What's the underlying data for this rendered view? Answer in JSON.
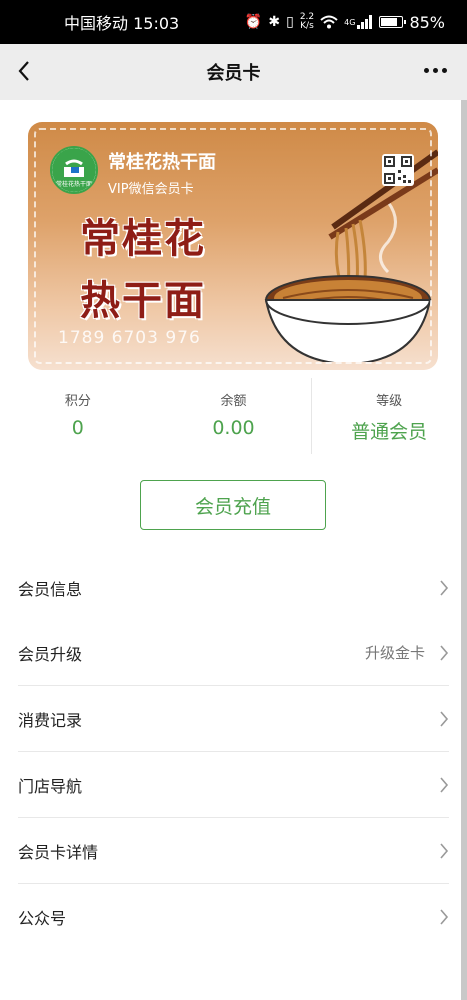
{
  "status_bar": {
    "carrier_time": "中国移动 15:03",
    "speed_top": "2.2",
    "speed_bottom": "K/s",
    "network": "4G",
    "battery_percent": "85%",
    "battery_level": 0.85
  },
  "nav": {
    "title": "会员卡"
  },
  "card": {
    "store_name": "常桂花热干面",
    "card_type": "VIP微信会员卡",
    "big_title_line1": "常桂花",
    "big_title_line2": "热干面",
    "card_number": "1789 6703 976",
    "logo_text": "常桂花热干面",
    "colors": {
      "title_red": "#8e1d16",
      "card_orange": "#cf8a47"
    }
  },
  "stats": [
    {
      "label": "积分",
      "value": "0"
    },
    {
      "label": "余额",
      "value": "0.00"
    },
    {
      "label": "等级",
      "value": "普通会员"
    }
  ],
  "recharge_button": "会员充值",
  "menu": [
    {
      "label": "会员信息",
      "extra": ""
    },
    {
      "label": "会员升级",
      "extra": "升级金卡"
    },
    {
      "label": "消费记录",
      "extra": ""
    },
    {
      "label": "门店导航",
      "extra": ""
    },
    {
      "label": "会员卡详情",
      "extra": ""
    },
    {
      "label": "公众号",
      "extra": ""
    }
  ],
  "accent_color": "#4ea34e"
}
